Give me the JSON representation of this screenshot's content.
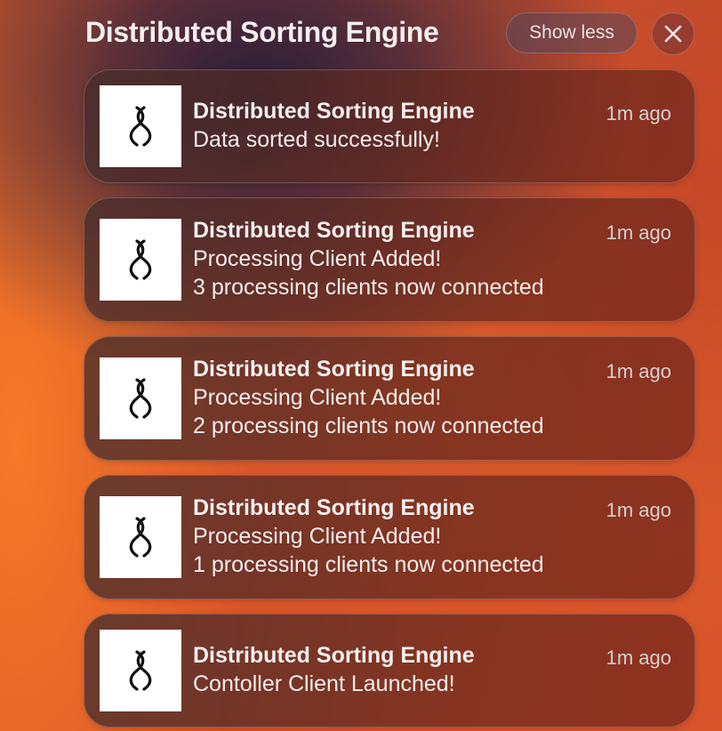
{
  "group": {
    "title": "Distributed Sorting Engine",
    "show_less_label": "Show less",
    "close_icon": "close-icon"
  },
  "notifications": [
    {
      "app_name": "Distributed Sorting Engine",
      "time": "1m ago",
      "message": "Data sorted successfully!",
      "detail": "",
      "icon": "sorting-engine-logo-icon"
    },
    {
      "app_name": "Distributed Sorting Engine",
      "time": "1m ago",
      "message": "Processing Client Added!",
      "detail": "3 processing clients now connected",
      "icon": "sorting-engine-logo-icon"
    },
    {
      "app_name": "Distributed Sorting Engine",
      "time": "1m ago",
      "message": "Processing Client Added!",
      "detail": "2 processing clients now connected",
      "icon": "sorting-engine-logo-icon"
    },
    {
      "app_name": "Distributed Sorting Engine",
      "time": "1m ago",
      "message": "Processing Client Added!",
      "detail": "1 processing clients now connected",
      "icon": "sorting-engine-logo-icon"
    },
    {
      "app_name": "Distributed Sorting Engine",
      "time": "1m ago",
      "message": "Contoller Client Launched!",
      "detail": "",
      "icon": "sorting-engine-logo-icon"
    }
  ]
}
